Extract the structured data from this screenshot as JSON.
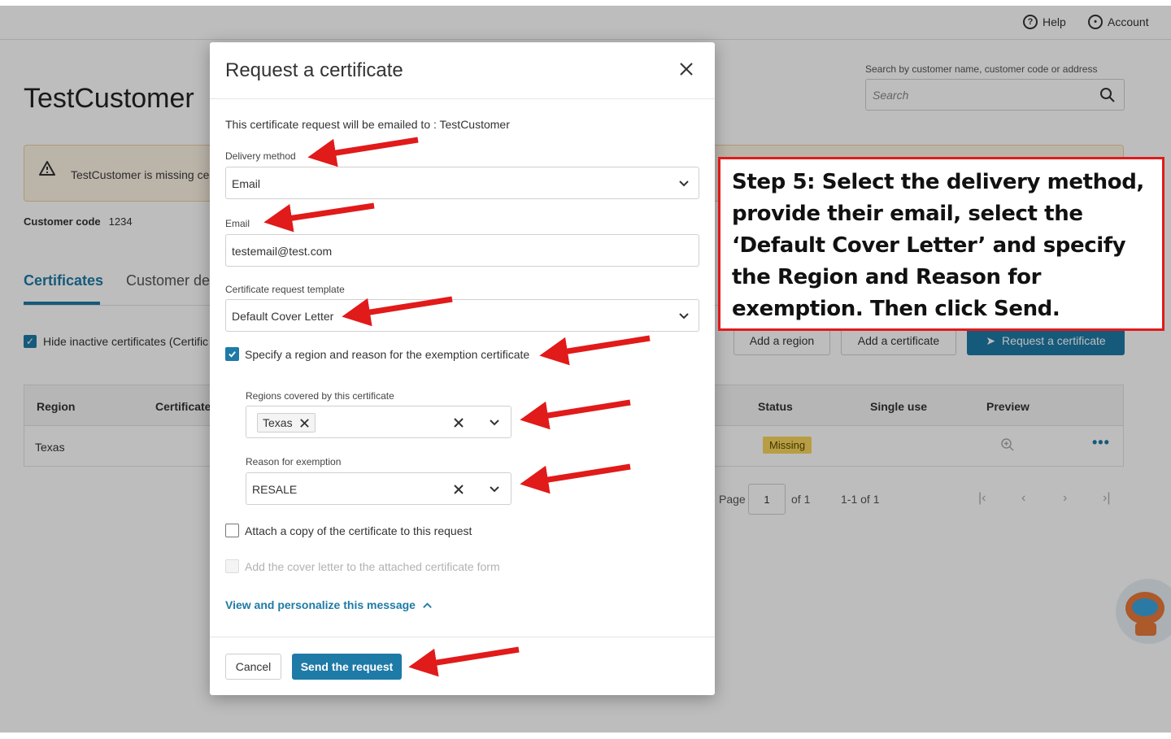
{
  "topbar": {
    "help_label": "Help",
    "account_label": "Account"
  },
  "customer": {
    "name": "TestCustomer",
    "alert_text": "TestCustomer is missing cer",
    "code_label": "Customer code",
    "code_value": "1234"
  },
  "search": {
    "label": "Search by customer name, customer code or address",
    "placeholder": "Search"
  },
  "tabs": {
    "certificates": "Certificates",
    "details": "Customer de"
  },
  "filters": {
    "hide_inactive": "Hide inactive certificates (Certific"
  },
  "actions": {
    "add_region": "Add a region",
    "add_certificate": "Add a certificate",
    "request_certificate": "Request a certificate"
  },
  "table": {
    "headers": {
      "region": "Region",
      "certificate": "Certificate",
      "status": "Status",
      "single_use": "Single use",
      "preview": "Preview"
    },
    "rows": [
      {
        "region": "Texas",
        "status": "Missing"
      }
    ]
  },
  "pagination": {
    "page_label": "Page",
    "page_value": "1",
    "of_label": "of 1",
    "range": "1-1 of 1"
  },
  "modal": {
    "title": "Request a certificate",
    "info": "This certificate request will be emailed to : TestCustomer",
    "delivery_label": "Delivery method",
    "delivery_value": "Email",
    "email_label": "Email",
    "email_value": "testemail@test.com",
    "template_label": "Certificate request template",
    "template_value": "Default Cover Letter",
    "specify_label": "Specify a region and reason for the exemption certificate",
    "regions_label": "Regions covered by this certificate",
    "region_tag": "Texas",
    "reason_label": "Reason for exemption",
    "reason_value": "RESALE",
    "attach_label": "Attach a copy of the certificate to this request",
    "cover_label": "Add the cover letter to the attached certificate form",
    "view_link": "View and personalize this message",
    "cancel_label": "Cancel",
    "send_label": "Send the request"
  },
  "annotation": {
    "text": "Step 5: Select the delivery method, provide their email, select the ‘Default Cover Letter’ and specify the Region and Reason for exemption. Then click Send."
  },
  "colors": {
    "accent": "#1e7aa6",
    "annotation_red": "#e11a1a",
    "badge_yellow": "#f7d55c"
  }
}
